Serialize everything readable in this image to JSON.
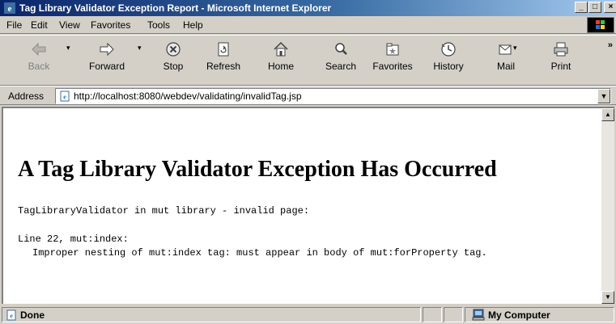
{
  "window": {
    "title": "Tag Library Validator Exception Report - Microsoft Internet Explorer",
    "minimize": "_",
    "maximize": "□",
    "close": "×"
  },
  "menu": [
    {
      "label": "File"
    },
    {
      "label": "Edit"
    },
    {
      "label": "View"
    },
    {
      "label": "Favorites"
    },
    {
      "label": "Tools"
    },
    {
      "label": "Help"
    }
  ],
  "toolbar": {
    "buttons": [
      {
        "label": "Back",
        "icon": "back-arrow-icon",
        "disabled": true
      },
      {
        "label": "Forward",
        "icon": "forward-arrow-icon",
        "disabled": false
      },
      {
        "label": "Stop",
        "icon": "stop-icon",
        "disabled": false
      },
      {
        "label": "Refresh",
        "icon": "refresh-icon",
        "disabled": false
      },
      {
        "label": "Home",
        "icon": "home-icon",
        "disabled": false
      },
      {
        "label": "Search",
        "icon": "search-icon",
        "disabled": false
      },
      {
        "label": "Favorites",
        "icon": "favorites-icon",
        "disabled": false
      },
      {
        "label": "History",
        "icon": "history-icon",
        "disabled": false
      },
      {
        "label": "Mail",
        "icon": "mail-icon",
        "disabled": false
      },
      {
        "label": "Print",
        "icon": "print-icon",
        "disabled": false
      }
    ],
    "overflow": "»"
  },
  "address": {
    "label": "Address",
    "url": "http://localhost:8080/webdev/validating/invalidTag.jsp"
  },
  "page": {
    "heading": "A Tag Library Validator Exception Has Occurred",
    "message": "TagLibraryValidator in mut library - invalid page:",
    "error_location": "Line 22, mut:index:",
    "error_detail": "Improper nesting of mut:index tag: must appear in body of mut:forProperty tag."
  },
  "status": {
    "text": "Done",
    "zone": "My Computer"
  },
  "colors": {
    "titlebar_start": "#0a246a",
    "titlebar_end": "#a6caf0",
    "chrome": "#d4d0c8",
    "content_bg": "#ffffff"
  }
}
